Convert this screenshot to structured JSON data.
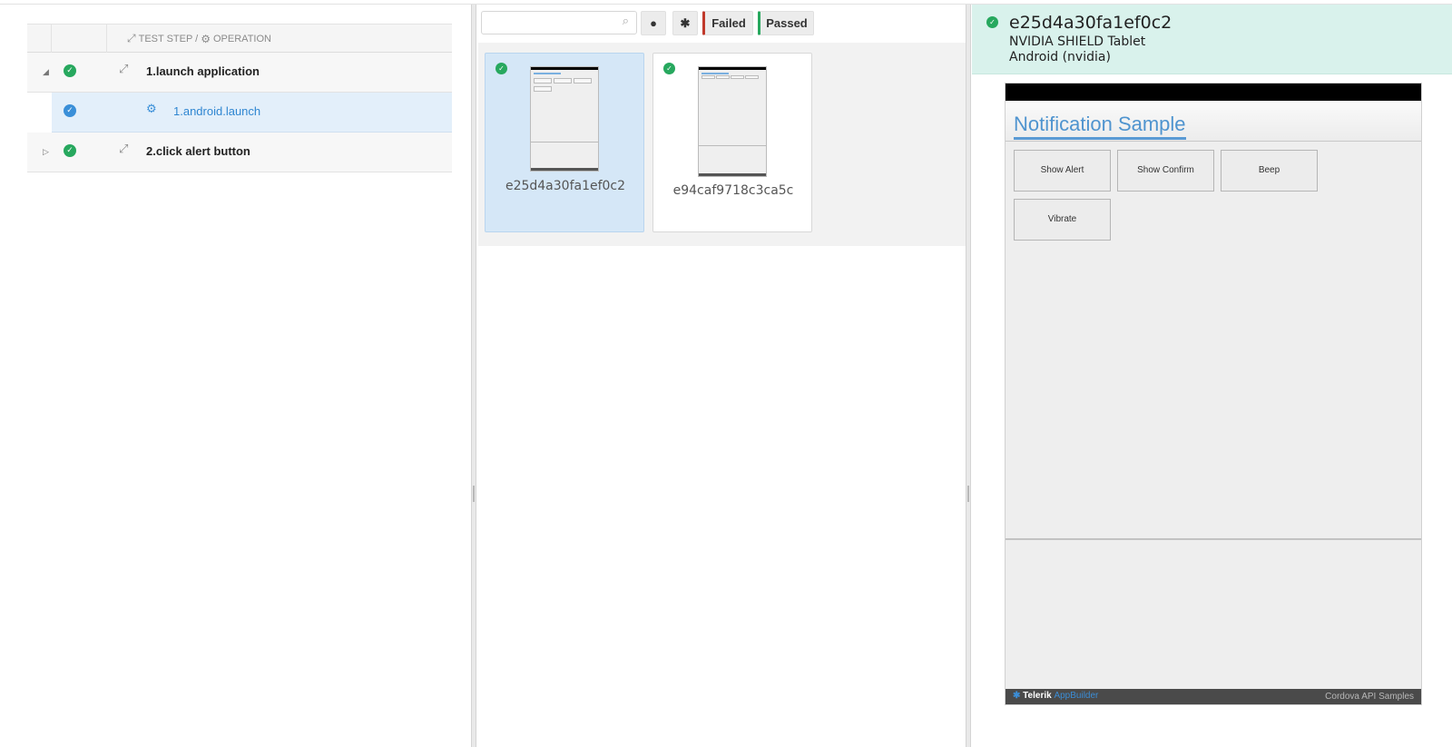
{
  "left": {
    "header": {
      "test_step": "TEST STEP /",
      "operation": "OPERATION"
    },
    "rows": [
      {
        "label": "1.launch application",
        "expand": "◢",
        "status": "passed"
      },
      {
        "label": "1.android.launch",
        "status": "passed-selected"
      },
      {
        "label": "2.click alert button",
        "expand": "▷",
        "status": "passed"
      }
    ]
  },
  "middle": {
    "search": {
      "placeholder": ""
    },
    "filters": {
      "apple_icon": "apple-icon",
      "android_icon": "android-icon",
      "failed": "Failed",
      "passed": "Passed"
    },
    "devices": [
      {
        "name": "e25d4a30fa1ef0c2",
        "selected": true,
        "status": "passed"
      },
      {
        "name": "e94caf9718c3ca5c",
        "selected": false,
        "status": "passed"
      }
    ]
  },
  "right": {
    "device_name": "e25d4a30fa1ef0c2",
    "model": "NVIDIA SHIELD Tablet",
    "os": "Android (nvidia)",
    "screen": {
      "title": "Notification Sample",
      "buttons": [
        "Show Alert",
        "Show Confirm",
        "Beep",
        "Vibrate"
      ],
      "footer_brand": "Telerik",
      "footer_product": "AppBuilder",
      "footer_right": "Cordova API Samples"
    }
  },
  "colors": {
    "passed": "#27a85e",
    "failed": "#c0392b",
    "accent": "#3a8fd8",
    "header_bg": "#d9f2ec"
  }
}
